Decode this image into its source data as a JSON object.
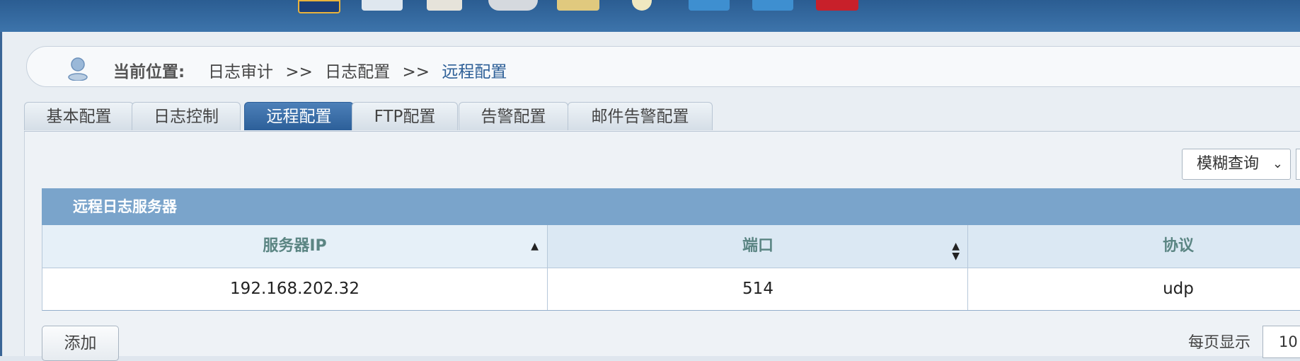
{
  "toolbar": {
    "icons": [
      "home-icon",
      "monitor-icon",
      "document-edit-icon",
      "gear-icon",
      "folder-icon",
      "user-icon",
      "chart-icon",
      "report-icon",
      "exit-icon"
    ]
  },
  "breadcrumb": {
    "label": "当前位置:",
    "items": [
      "日志审计",
      "日志配置",
      "远程配置"
    ],
    "separator": ">>"
  },
  "tabs": [
    {
      "label": "基本配置",
      "active": false
    },
    {
      "label": "日志控制",
      "active": false
    },
    {
      "label": "远程配置",
      "active": true
    },
    {
      "label": "FTP配置",
      "active": false
    },
    {
      "label": "告警配置",
      "active": false
    },
    {
      "label": "邮件告警配置",
      "active": false
    }
  ],
  "search": {
    "mode_label": "模糊查询"
  },
  "grid": {
    "title": "远程日志服务器",
    "columns": [
      "服务器IP",
      "端口",
      "协议"
    ],
    "rows": [
      [
        "192.168.202.32",
        "514",
        "udp"
      ]
    ]
  },
  "footer": {
    "add_label": "添加",
    "per_page_label": "每页显示",
    "per_page_value": "10"
  },
  "colors": {
    "header_bar": "#3d74ab",
    "active_tab": "#2c5f99",
    "grid_title": "#7aa4cb",
    "column_header_text": "#5b8583"
  }
}
